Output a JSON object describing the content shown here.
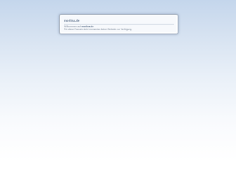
{
  "notice": {
    "domain": "morlina.de",
    "welcome_prefix": "Willkommen auf",
    "welcome_domain": "morlina.de",
    "message": "Für diese Domain steht momentan keine Website zur Verfügung."
  },
  "colors": {
    "background_top": "#c4d6ec",
    "background_bottom": "#ffffff",
    "card_border": "#9aa6b6",
    "title_text": "#5b6f8a",
    "body_text": "#7d8a9a"
  }
}
